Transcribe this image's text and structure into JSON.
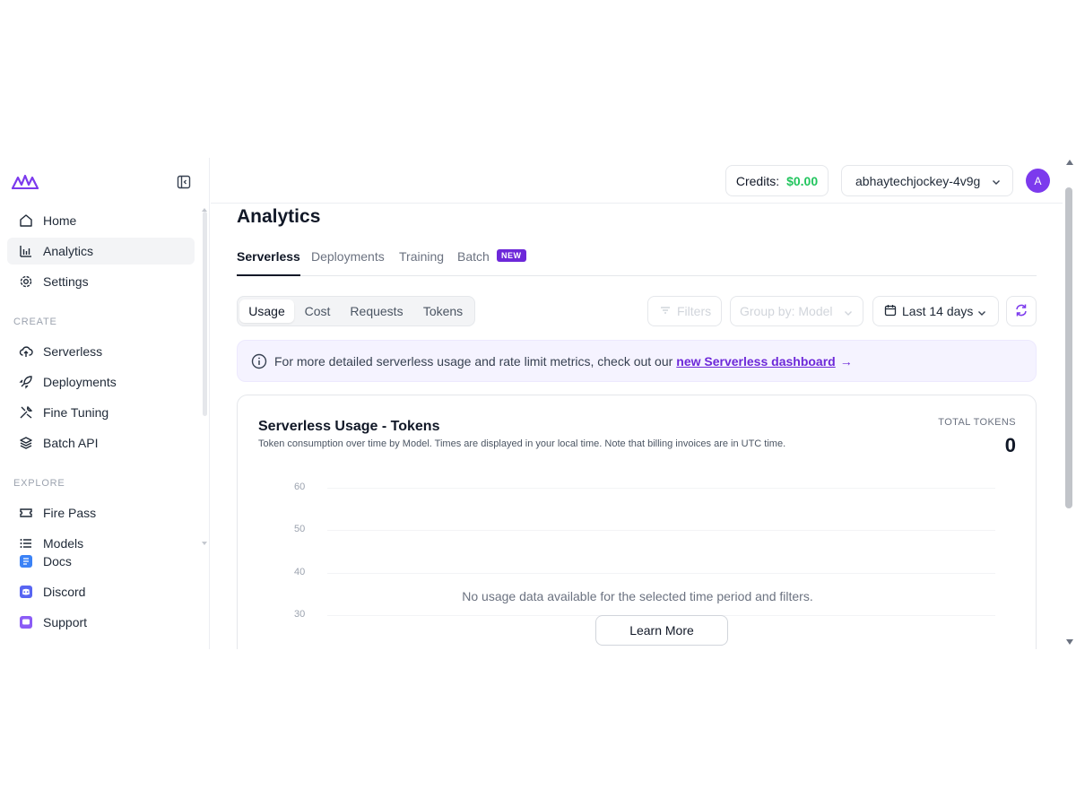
{
  "sidebar": {
    "logo_icon": "fireworks-logo-icon",
    "collapse_icon": "sidebar-collapse-icon",
    "items_main": [
      {
        "label": "Home",
        "icon": "home-icon"
      },
      {
        "label": "Analytics",
        "icon": "bar-chart-icon",
        "active": true
      },
      {
        "label": "Settings",
        "icon": "gear-icon"
      }
    ],
    "section_create": "CREATE",
    "items_create": [
      {
        "label": "Serverless",
        "icon": "cloud-upload-icon"
      },
      {
        "label": "Deployments",
        "icon": "rocket-icon"
      },
      {
        "label": "Fine Tuning",
        "icon": "tools-icon"
      },
      {
        "label": "Batch API",
        "icon": "layers-icon"
      }
    ],
    "section_explore": "EXPLORE",
    "items_explore": [
      {
        "label": "Fire Pass",
        "icon": "ticket-icon"
      },
      {
        "label": "Models",
        "icon": "list-icon"
      }
    ],
    "items_bottom": [
      {
        "label": "Docs",
        "icon": "docs-icon"
      },
      {
        "label": "Discord",
        "icon": "discord-icon"
      },
      {
        "label": "Support",
        "icon": "support-chat-icon"
      }
    ]
  },
  "topbar": {
    "credits_label": "Credits:",
    "credits_value": "$0.00",
    "account_name": "abhaytechjockey-4v9g",
    "avatar_initial": "A"
  },
  "main": {
    "title": "Analytics",
    "tabs": [
      {
        "label": "Serverless",
        "active": true
      },
      {
        "label": "Deployments"
      },
      {
        "label": "Training"
      },
      {
        "label": "Batch"
      }
    ],
    "batch_badge": "NEW",
    "segments": [
      {
        "label": "Usage",
        "active": true
      },
      {
        "label": "Cost"
      },
      {
        "label": "Requests"
      },
      {
        "label": "Tokens"
      }
    ],
    "filters_label": "Filters",
    "group_by_label": "Group by: Model",
    "date_range_label": "Last 14 days",
    "notice": {
      "text": "For more detailed serverless usage and rate limit metrics, check out our",
      "link": "new Serverless dashboard",
      "arrow": "→"
    },
    "card": {
      "title": "Serverless Usage - Tokens",
      "subtitle": "Token consumption over time by Model. Times are displayed in your local time. Note that billing invoices are in UTC time.",
      "total_label": "TOTAL TOKENS",
      "total_value": "0",
      "y_ticks": [
        "60",
        "50",
        "40",
        "30"
      ],
      "empty_message": "No usage data available for the selected time period and filters.",
      "learn_more": "Learn More"
    }
  },
  "colors": {
    "accent": "#6d28d9",
    "credits_green": "#22c55e",
    "avatar": "#7c3aed"
  }
}
